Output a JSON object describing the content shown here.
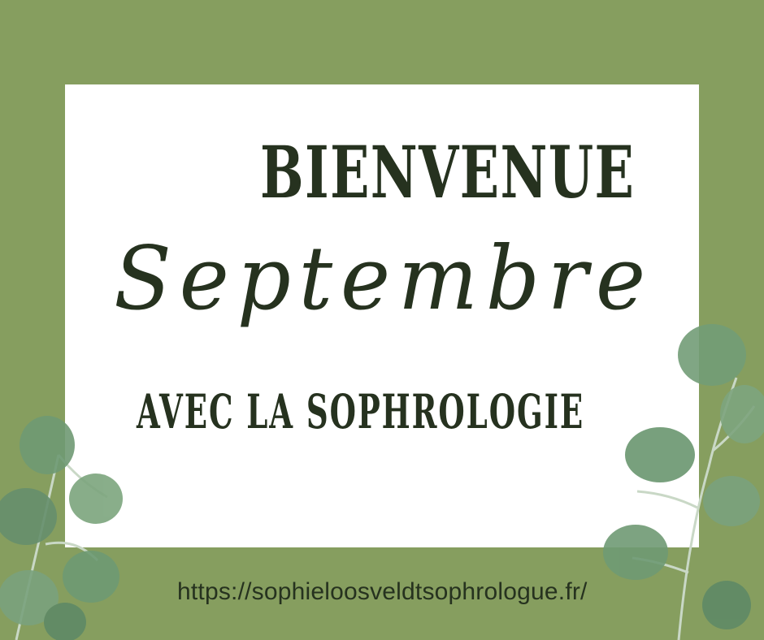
{
  "card": {
    "title": "BIENVENUE",
    "script": "Septembre",
    "subtitle": "AVEC LA SOPHROLOGIE"
  },
  "footer": {
    "url": "https://sophieloosveldtsophrologue.fr/"
  },
  "colors": {
    "background": "#869e5f",
    "card": "#ffffff",
    "text": "#26321f",
    "leaf": "#7fa37f"
  }
}
